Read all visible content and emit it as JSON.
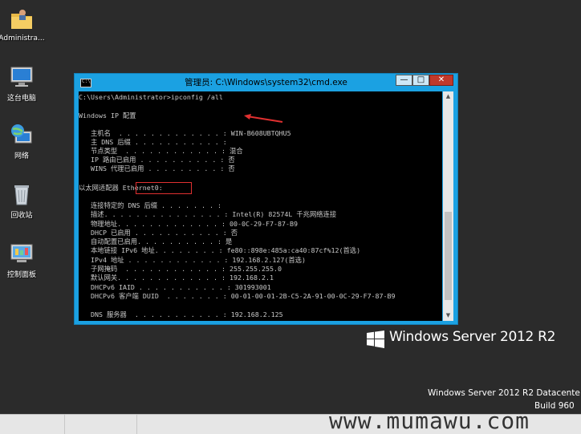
{
  "desktop": {
    "icons": [
      {
        "label": "Administra...",
        "icon": "folder-user-icon"
      },
      {
        "label": "这台电脑",
        "icon": "computer-icon"
      },
      {
        "label": "网络",
        "icon": "network-globe-icon"
      },
      {
        "label": "回收站",
        "icon": "recycle-bin-icon"
      },
      {
        "label": "控制面板",
        "icon": "control-panel-icon"
      }
    ],
    "brand": "Windows Server 2012 R2",
    "version_line1": "Windows Server 2012 R2 Datacente",
    "version_line2": "Build 960",
    "watermark": "www.mumawu.com"
  },
  "window": {
    "title": "管理员: C:\\Windows\\system32\\cmd.exe",
    "icon_label": "C:\\",
    "buttons": {
      "minimize": "—",
      "maximize": "□",
      "close": "✕"
    },
    "accent_color": "#1ba1e2",
    "close_color": "#c0392b",
    "highlight_color": "#e03030"
  },
  "console": {
    "lines": [
      "C:\\Users\\Administrator>ipconfig /all",
      "",
      "Windows IP 配置",
      "",
      "   主机名  . . . . . . . . . . . . . : WIN-B608UBTQHU5",
      "   主 DNS 后缀 . . . . . . . . . . . :",
      "   节点类型  . . . . . . . . . . . . : 混合",
      "   IP 路由已启用 . . . . . . . . . . : 否",
      "   WINS 代理已启用 . . . . . . . . . : 否",
      "",
      "以太网适配器 Ethernet0:",
      "",
      "   连接特定的 DNS 后缀 . . . . . . . :",
      "   描述. . . . . . . . . . . . . . . : Intel(R) 82574L 千兆网络连接",
      "   物理地址. . . . . . . . . . . . . : 00-0C-29-F7-87-B9",
      "   DHCP 已启用 . . . . . . . . . . . : 否",
      "   自动配置已启用. . . . . . . . . . : 是",
      "   本地链接 IPv6 地址. . . . . . . . : fe80::898e:485a:ca40:87cf%12(首选)",
      "   IPv4 地址 . . . . . . . . . . . . : 192.168.2.127(首选)",
      "   子网掩码  . . . . . . . . . . . . : 255.255.255.0",
      "   默认网关. . . . . . . . . . . . . : 192.168.2.1",
      "   DHCPv6 IAID . . . . . . . . . . . : 301993001",
      "   DHCPv6 客户端 DUID  . . . . . . . : 00-01-00-01-2B-C5-2A-91-00-0C-29-F7-87-B9",
      "",
      "   DNS 服务器  . . . . . . . . . . . : 192.168.2.125"
    ]
  }
}
